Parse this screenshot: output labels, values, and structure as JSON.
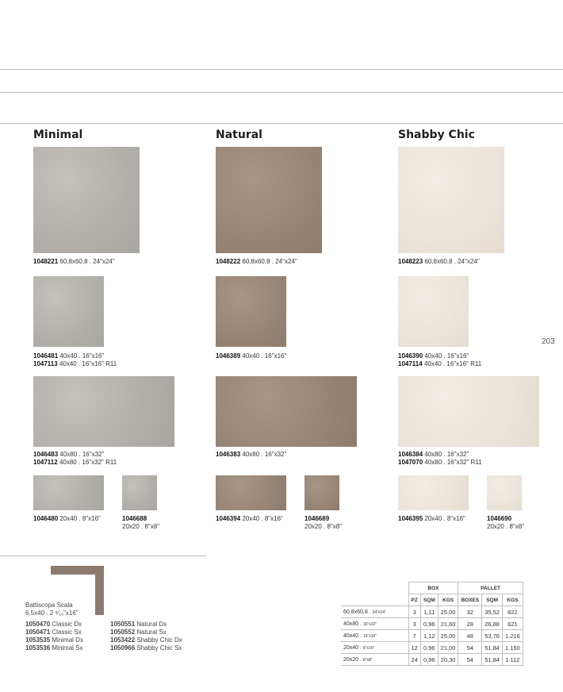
{
  "columns": [
    {
      "title": "Minimal",
      "variant": "minimal"
    },
    {
      "title": "Natural",
      "variant": "natural"
    },
    {
      "title": "Shabby Chic",
      "variant": "shabby"
    }
  ],
  "captions": {
    "m1": [
      {
        "code": "1048221",
        "desc": "60,8x60,8 . 24\"x24\""
      }
    ],
    "m2": [
      {
        "code": "1046481",
        "desc": "40x40 . 16\"x16\""
      },
      {
        "code": "1047113",
        "desc": "40x40 . 16\"x16\" R11"
      }
    ],
    "m3": [
      {
        "code": "1046483",
        "desc": "40x80 . 16\"x32\""
      },
      {
        "code": "1047112",
        "desc": "40x80 . 16\"x32\" R11"
      }
    ],
    "m4": [
      {
        "code": "1046480",
        "desc": "20x40 . 8\"x16\""
      }
    ],
    "m5": [
      {
        "code": "1046688",
        "desc": "20x20 . 8\"x8\""
      }
    ],
    "n1": [
      {
        "code": "1048222",
        "desc": "60,8x60,8 . 24\"x24\""
      }
    ],
    "n2": [
      {
        "code": "1046389",
        "desc": "40x40 . 16\"x16\""
      }
    ],
    "n3": [
      {
        "code": "1046383",
        "desc": "40x80 . 16\"x32\""
      }
    ],
    "n4": [
      {
        "code": "1046394",
        "desc": "20x40 . 8\"x16\""
      }
    ],
    "n5": [
      {
        "code": "1046689",
        "desc": "20x20 . 8\"x8\""
      }
    ],
    "s1": [
      {
        "code": "1048223",
        "desc": "60,8x60,8 . 24\"x24\""
      }
    ],
    "s2": [
      {
        "code": "1046390",
        "desc": "40x40 . 16\"x16\""
      },
      {
        "code": "1047114",
        "desc": "40x40 . 16\"x16\" R11"
      }
    ],
    "s3": [
      {
        "code": "1046384",
        "desc": "40x80 . 16\"x32\""
      },
      {
        "code": "1047070",
        "desc": "40x80 . 16\"x32\" R11"
      }
    ],
    "s4": [
      {
        "code": "1046395",
        "desc": "20x40 . 8\"x16\""
      }
    ],
    "s5": [
      {
        "code": "1046690",
        "desc": "20x20 . 8\"x8\""
      }
    ]
  },
  "page_number": "203",
  "skirting": {
    "title": "Battiscopa Scala",
    "size": "6,5x40 . 2 ⁹⁄₁₆\"x16\"",
    "left": [
      {
        "code": "1050470",
        "desc": "Classic Dx"
      },
      {
        "code": "1050471",
        "desc": "Classic Sx"
      },
      {
        "code": "1053535",
        "desc": "Minimal Dx"
      },
      {
        "code": "1053536",
        "desc": "Minimal Sx"
      }
    ],
    "right": [
      {
        "code": "1050551",
        "desc": "Natural Dx"
      },
      {
        "code": "1050552",
        "desc": "Natural Sx"
      },
      {
        "code": "1053422",
        "desc": "Shabby Chic Dx"
      },
      {
        "code": "1050966",
        "desc": "Shabby Chic Sx"
      }
    ]
  },
  "table": {
    "group_box": "BOX",
    "group_pallet": "PALLET",
    "headers": [
      "PZ",
      "SQM",
      "KGS",
      "BOXES",
      "SQM",
      "KGS"
    ],
    "rows": [
      {
        "fmt": "60,8x60,8",
        "imp": "24\"x24\"",
        "vals": [
          "3",
          "1,11",
          "25,00",
          "32",
          "35,52",
          "822"
        ]
      },
      {
        "fmt": "40x80",
        "imp": "16\"x32\"",
        "vals": [
          "3",
          "0,96",
          "21,60",
          "28",
          "26,88",
          "621"
        ]
      },
      {
        "fmt": "40x40",
        "imp": "16\"x16\"",
        "vals": [
          "7",
          "1,12",
          "25,00",
          "48",
          "53,76",
          "1.216"
        ]
      },
      {
        "fmt": "20x40",
        "imp": "8\"x16\"",
        "vals": [
          "12",
          "0,96",
          "21,00",
          "54",
          "51,84",
          "1.150"
        ]
      },
      {
        "fmt": "20x20",
        "imp": "8\"x8\"",
        "vals": [
          "24",
          "0,96",
          "20,30",
          "54",
          "51,84",
          "1.112"
        ]
      }
    ]
  }
}
